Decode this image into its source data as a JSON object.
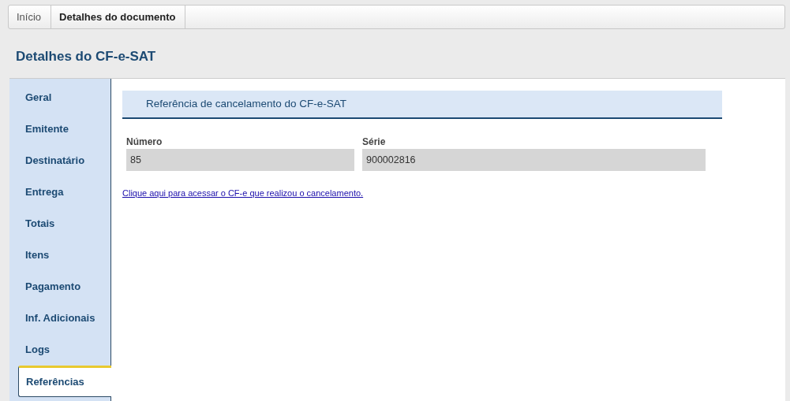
{
  "breadcrumb": [
    {
      "label": "Início",
      "current": false
    },
    {
      "label": "Detalhes do documento",
      "current": true
    }
  ],
  "page_title": "Detalhes do CF-e-SAT",
  "sidebar": {
    "items": [
      {
        "label": "Geral",
        "selected": false
      },
      {
        "label": "Emitente",
        "selected": false
      },
      {
        "label": "Destinatário",
        "selected": false
      },
      {
        "label": "Entrega",
        "selected": false
      },
      {
        "label": "Totais",
        "selected": false
      },
      {
        "label": "Itens",
        "selected": false
      },
      {
        "label": "Pagamento",
        "selected": false
      },
      {
        "label": "Inf. Adicionais",
        "selected": false
      },
      {
        "label": "Logs",
        "selected": false
      },
      {
        "label": "Referências",
        "selected": true
      }
    ]
  },
  "section": {
    "title": "Referência de cancelamento do CF-e-SAT",
    "fields": [
      {
        "label": "Número",
        "value": "85"
      },
      {
        "label": "Série",
        "value": "900002816"
      }
    ],
    "link": "Clique aqui para acessar o CF-e que realizou o cancelamento."
  }
}
